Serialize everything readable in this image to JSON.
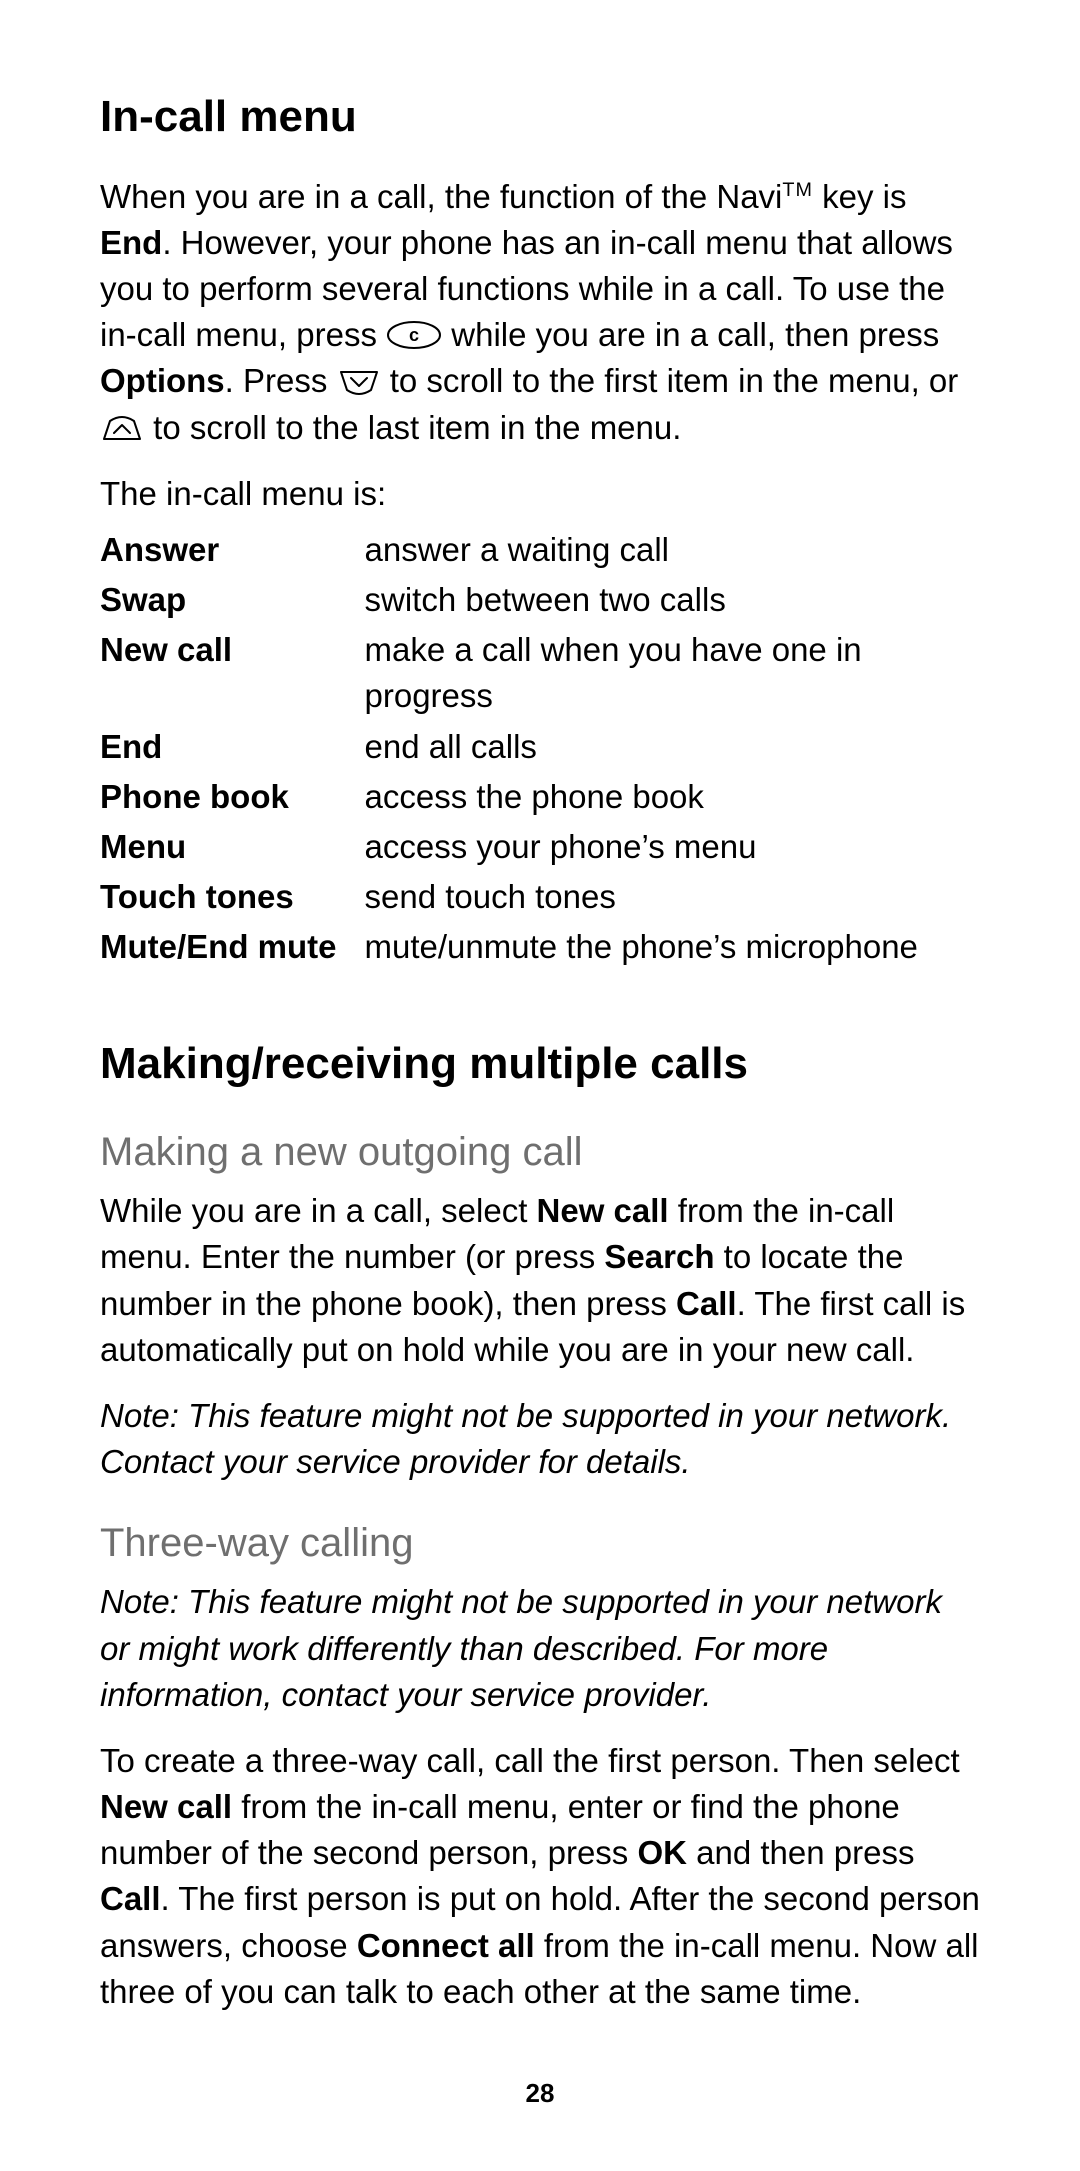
{
  "h1a": "In-call menu",
  "intro": {
    "p1_a": "When you are in a call, the function of the Navi",
    "tm": "TM",
    "p1_b": " key is ",
    "end": "End",
    "p1_c": ". However, your phone has an in-call menu that allows you to perform several functions while in a call. To use the in-call menu, press ",
    "p1_d": " while you are in a call, then press ",
    "options": "Options",
    "p1_e": ". Press ",
    "p1_f": " to scroll to the first item in the menu, or ",
    "p1_g": " to scroll to the last item in the menu."
  },
  "menu_lead": "The in-call menu is:",
  "menu": [
    {
      "label": "Answer",
      "desc": "answer a waiting call"
    },
    {
      "label": "Swap",
      "desc": "switch between two calls"
    },
    {
      "label": "New call",
      "desc": "make a call when you have one in progress"
    },
    {
      "label": "End",
      "desc": "end all calls"
    },
    {
      "label": "Phone book",
      "desc": "access the phone book"
    },
    {
      "label": "Menu",
      "desc": "access your phone’s menu"
    },
    {
      "label": "Touch tones",
      "desc": "send touch tones"
    },
    {
      "label": "Mute/End mute",
      "desc": "mute/unmute the phone’s microphone"
    }
  ],
  "h1b": "Making/receiving multiple calls",
  "h2a": "Making a new outgoing call",
  "out": {
    "a": "While you are in a call, select ",
    "newcall": "New call",
    "b": " from the in-call menu. Enter the number (or press ",
    "search": "Search",
    "c": " to locate the number in the phone book), then press ",
    "call": "Call",
    "d": ". The first call is automatically put on hold while you are in your new call."
  },
  "note1": "Note:  This feature might not be supported in your network. Contact your service provider for details.",
  "h2b": "Three-way calling",
  "note2": "Note:  This feature might not be supported in your network or might work differently than described. For more information, contact your service provider.",
  "three": {
    "a": "To create a three-way call, call the first person. Then select ",
    "newcall": "New call",
    "b": " from the in-call menu, enter or find the phone number of the second person, press ",
    "ok": "OK",
    "c": " and then press ",
    "call": "Call",
    "d": ". The first person is put on hold. After the second person answers, choose ",
    "connect": "Connect all",
    "e": " from the in-call menu. Now all three of you can talk to each other at the same time."
  },
  "pagenum": "28"
}
